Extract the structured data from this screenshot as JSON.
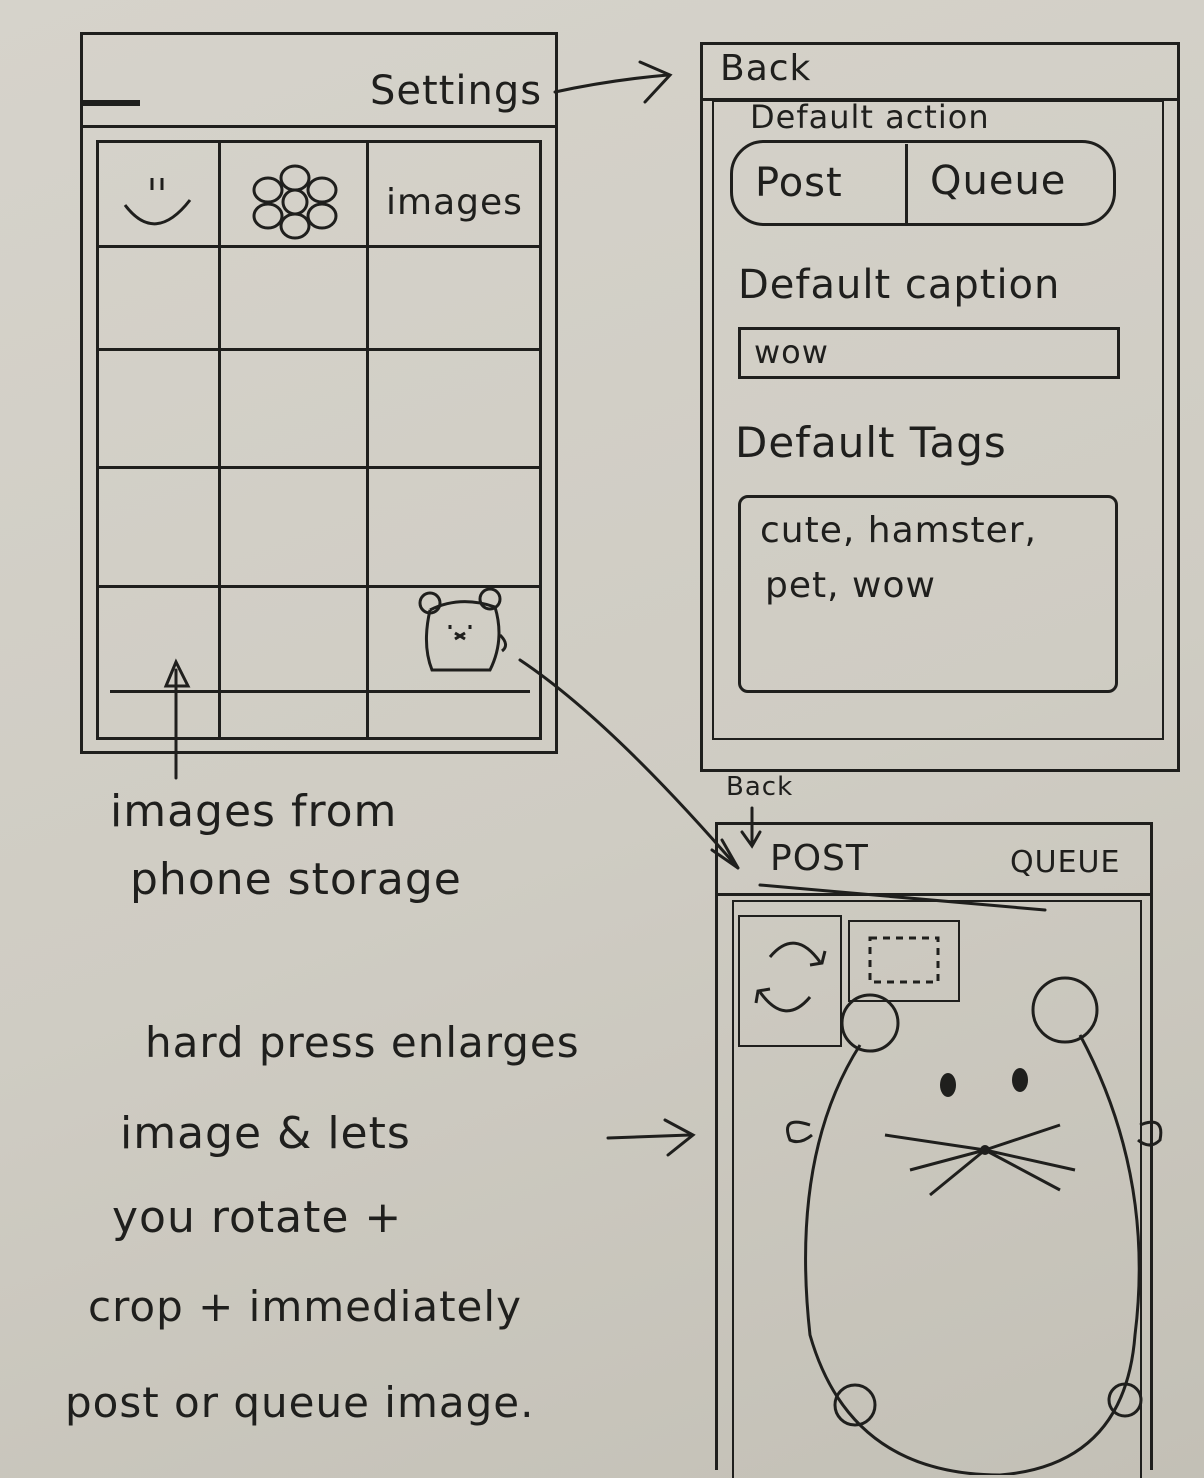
{
  "screen1": {
    "top_label": "Settings",
    "grid_header_label": "images"
  },
  "annotation_storage": {
    "line1": "images from",
    "line2": "phone storage"
  },
  "screen2": {
    "back_label": "Back",
    "default_action_label": "Default action",
    "segment_post": "Post",
    "segment_queue": "Queue",
    "default_caption_label": "Default caption",
    "caption_value": "wow",
    "default_tags_label": "Default Tags",
    "tags_line1": "cute, hamster,",
    "tags_line2": "pet, wow"
  },
  "screen3": {
    "back_label": "Back",
    "post_label": "POST",
    "queue_label": "QUEUE"
  },
  "annotation_press": {
    "line1": "hard press enlarges",
    "line2": "image & lets",
    "line3": "you rotate +",
    "line4": "crop + immediately",
    "line5": "post or queue image."
  }
}
